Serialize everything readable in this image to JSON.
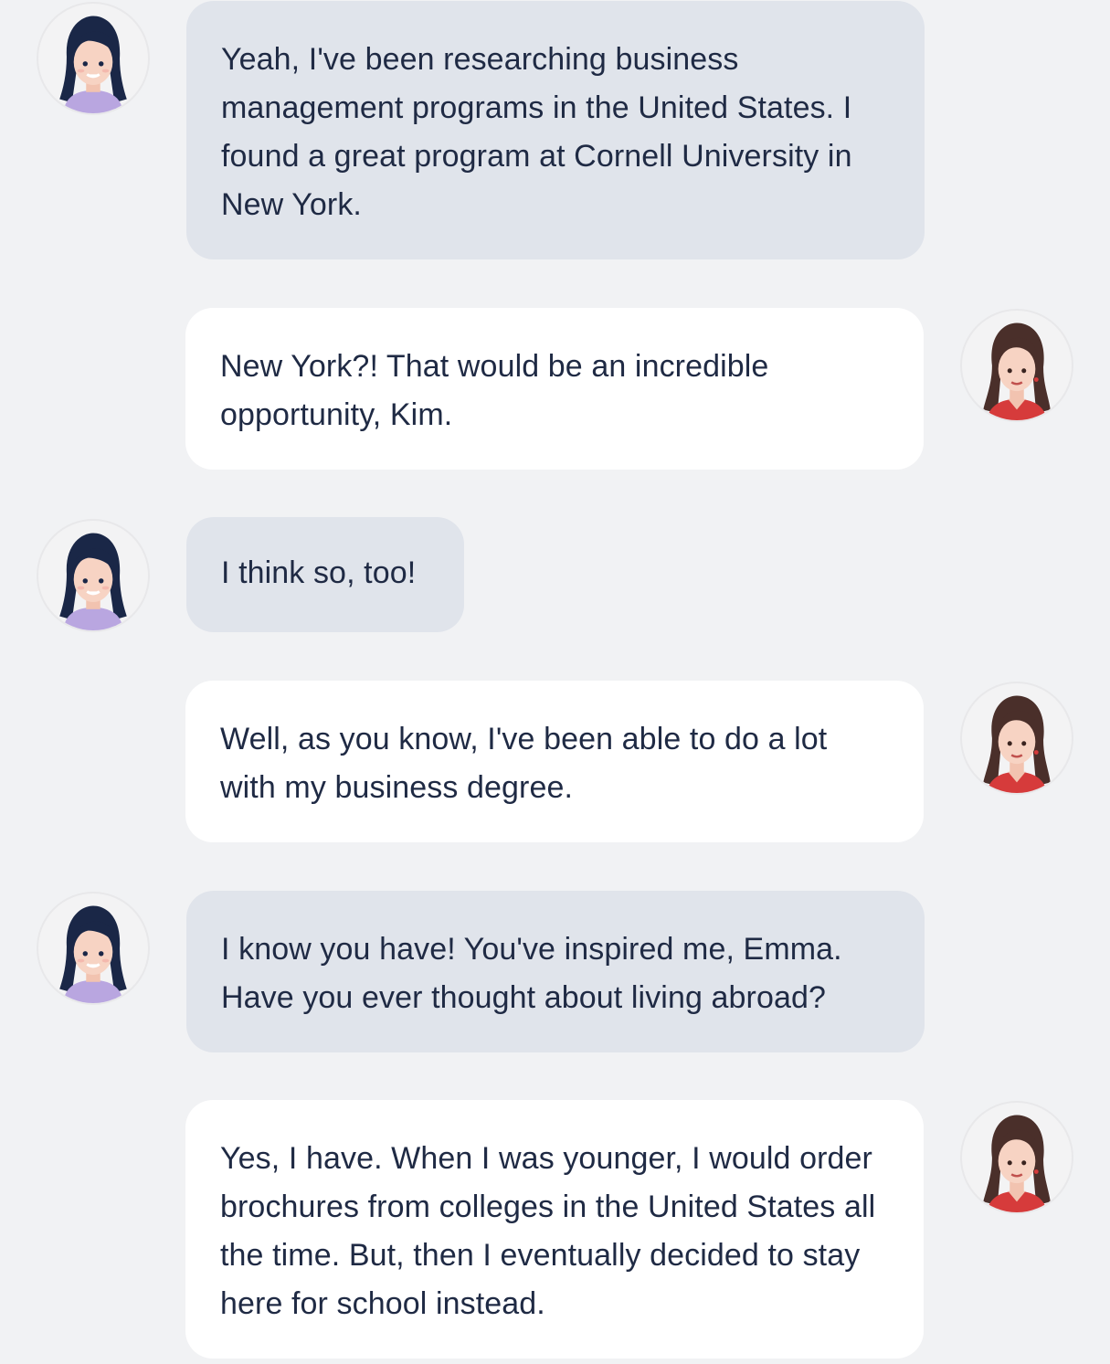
{
  "conversation": {
    "messages": [
      {
        "speaker": "Kim",
        "side": "left",
        "avatar": "kim-avatar-icon",
        "text": "Yeah, I've been researching business management programs in the United States. I found a great program at Cornell University in New York."
      },
      {
        "speaker": "Emma",
        "side": "right",
        "avatar": "emma-avatar-icon",
        "text": "New York?! That would be an incredible opportunity, Kim."
      },
      {
        "speaker": "Kim",
        "side": "left",
        "avatar": "kim-avatar-icon",
        "text": "I think so, too!"
      },
      {
        "speaker": "Emma",
        "side": "right",
        "avatar": "emma-avatar-icon",
        "text": "Well, as you know, I've been able to do a lot with my business degree."
      },
      {
        "speaker": "Kim",
        "side": "left",
        "avatar": "kim-avatar-icon",
        "text": "I know you have! You've inspired me, Emma. Have you ever thought about living abroad?"
      },
      {
        "speaker": "Emma",
        "side": "right",
        "avatar": "emma-avatar-icon",
        "text": "Yes, I have. When I was younger, I would order brochures from colleges in the United States all the time. But, then I eventually decided to stay here for school instead."
      }
    ]
  },
  "colors": {
    "page_background": "#f1f2f4",
    "left_bubble": "#e0e4eb",
    "right_bubble": "#ffffff",
    "text": "#1f2a44",
    "kim_hair": "#1a2747",
    "kim_shirt": "#b9a6e0",
    "emma_hair": "#4a2f2a",
    "emma_shirt": "#d63b3b"
  }
}
